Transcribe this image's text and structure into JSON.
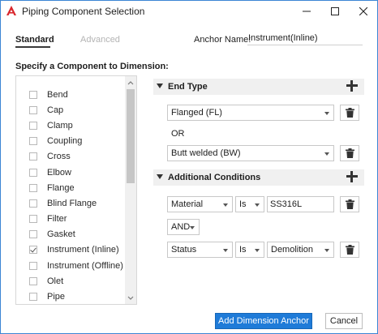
{
  "window": {
    "title": "Piping Component Selection",
    "accent": "#1f7bd8"
  },
  "tabs": [
    {
      "label": "Standard",
      "active": true
    },
    {
      "label": "Advanced",
      "active": false
    }
  ],
  "anchor": {
    "label": "Anchor Name:",
    "value": "Instrument(Inline)"
  },
  "component_section": {
    "label": "Specify a Component to Dimension:",
    "items": [
      {
        "label": "Bend",
        "checked": false
      },
      {
        "label": "Cap",
        "checked": false
      },
      {
        "label": "Clamp",
        "checked": false
      },
      {
        "label": "Coupling",
        "checked": false
      },
      {
        "label": "Cross",
        "checked": false
      },
      {
        "label": "Elbow",
        "checked": false
      },
      {
        "label": "Flange",
        "checked": false
      },
      {
        "label": "Blind Flange",
        "checked": false
      },
      {
        "label": "Filter",
        "checked": false
      },
      {
        "label": "Gasket",
        "checked": false
      },
      {
        "label": "Instrument (Inline)",
        "checked": true
      },
      {
        "label": "Instrument (Offline)",
        "checked": false
      },
      {
        "label": "Olet",
        "checked": false
      },
      {
        "label": "Pipe",
        "checked": false
      }
    ]
  },
  "end_type": {
    "title": "End Type",
    "first": "Flanged (FL)",
    "or_label": "OR",
    "second": "Butt welded (BW)"
  },
  "conditions": {
    "title": "Additional Conditions",
    "row1": {
      "property": "Material",
      "operator": "Is",
      "value": "SS316L"
    },
    "joiner": "AND",
    "row2": {
      "property": "Status",
      "operator": "Is",
      "value": "Demolition"
    }
  },
  "footer": {
    "primary": "Add Dimension Anchor",
    "cancel": "Cancel"
  }
}
